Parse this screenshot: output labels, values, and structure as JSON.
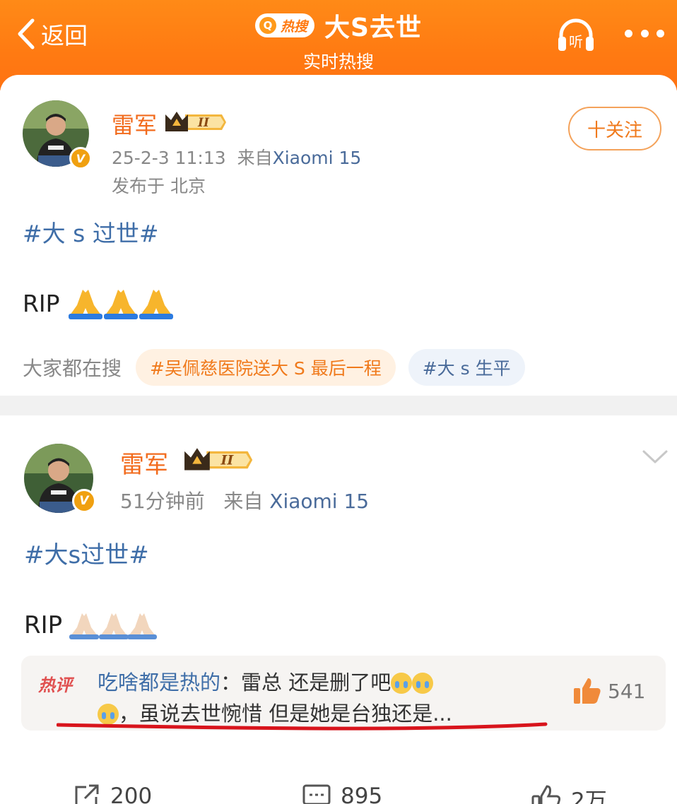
{
  "header": {
    "back_label": "返回",
    "hot_badge": "热搜",
    "hot_badge_icon": "Q",
    "title": "大S去世",
    "subtitle": "实时热搜",
    "listen_label": "听",
    "accent": "#ff7a12"
  },
  "post1": {
    "author": "雷军",
    "level": "II",
    "time": "25-2-3 11:13",
    "source_prefix": "来自",
    "source": "Xiaomi 15",
    "location": "发布于 北京",
    "follow_label": "十关注",
    "topic": "#大 s 过世#",
    "body": "RIP",
    "search_label": "大家都在搜",
    "search_tags": [
      "#吴佩慈医院送大 S 最后一程",
      "#大 s 生平"
    ]
  },
  "post2": {
    "author": "雷军",
    "level": "II",
    "time": "51分钟前",
    "source_prefix": "来自",
    "source": "Xiaomi 15",
    "topic": "#大s过世#",
    "body": "RIP",
    "hot_comment": {
      "label": "热评",
      "user": "吃啥都是热的",
      "line1": "：雷总 还是删了吧",
      "line2": "，虽说去世惋惜 但是她是台独还是...",
      "likes": "541"
    },
    "actions": {
      "repost": "200",
      "comment": "895",
      "like": "2万"
    }
  },
  "colors": {
    "name_orange": "#f26b1d",
    "link_blue": "#3f6ea8",
    "red_underline": "#d8141c"
  }
}
